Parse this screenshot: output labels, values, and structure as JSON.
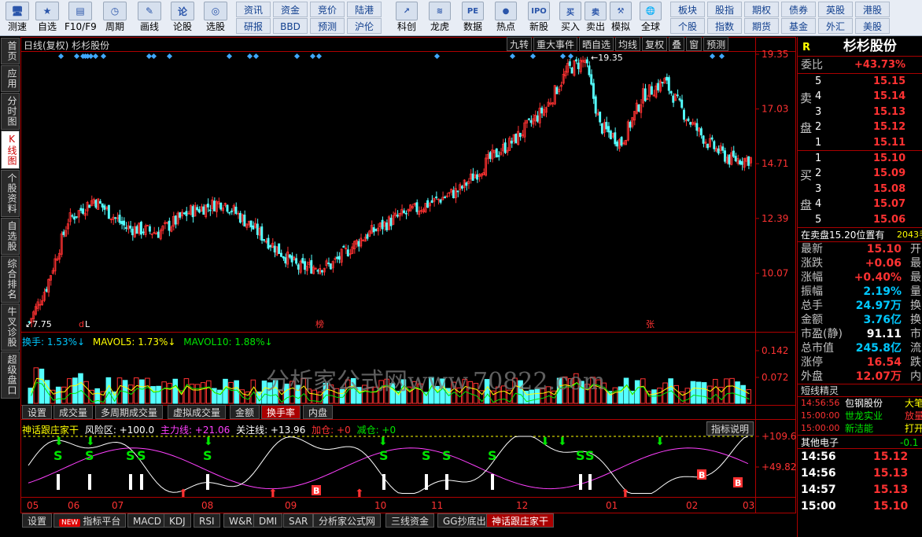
{
  "toolbar": {
    "items": [
      {
        "label": "测速",
        "icon": "🖥",
        "name": "speedtest-button"
      },
      {
        "label": "自选",
        "icon": "★",
        "name": "watchlist-button"
      },
      {
        "label": "F10/F9",
        "icon": "▤",
        "name": "f10-button"
      },
      {
        "label": "周期",
        "icon": "◷",
        "name": "period-button"
      },
      {
        "label": "画线",
        "icon": "✎",
        "name": "draw-line-button"
      },
      {
        "label": "论股",
        "icon": "论",
        "name": "forum-button"
      },
      {
        "label": "选股",
        "icon": "◎",
        "name": "stock-select-button"
      }
    ],
    "grid1": [
      "资讯",
      "资金",
      "竞价",
      "陆港",
      "研报",
      "BBD",
      "预测",
      "沪伦"
    ],
    "items2": [
      {
        "label": "科创",
        "icon": "↗",
        "name": "star-market-button"
      },
      {
        "label": "龙虎",
        "icon": "≋",
        "name": "dragon-tiger-button"
      },
      {
        "label": "数据",
        "icon": "PE",
        "name": "data-button"
      },
      {
        "label": "热点",
        "icon": "●",
        "name": "hotspot-button"
      },
      {
        "label": "新股",
        "icon": "IPO",
        "name": "ipo-button"
      },
      {
        "label": "买入",
        "icon": "买",
        "name": "buy-button"
      },
      {
        "label": "卖出",
        "icon": "卖",
        "name": "sell-button"
      },
      {
        "label": "模拟",
        "icon": "⚒",
        "name": "simulate-button"
      },
      {
        "label": "全球",
        "icon": "🌐",
        "name": "global-button"
      }
    ],
    "grid2": [
      "板块",
      "股指",
      "期权",
      "债券",
      "英股",
      "港股",
      "个股",
      "指数",
      "期货",
      "基金",
      "外汇",
      "美股"
    ]
  },
  "left_tabs": [
    {
      "label": "首页",
      "active": false
    },
    {
      "label": "应用",
      "active": false
    },
    {
      "label": "分时图",
      "active": false
    },
    {
      "label": "K线图",
      "active": true
    },
    {
      "label": "个股资料",
      "active": false
    },
    {
      "label": "自选股",
      "active": false
    },
    {
      "label": "综合排名",
      "active": false
    },
    {
      "label": "牛叉诊股",
      "active": false
    },
    {
      "label": "超级盘口",
      "active": false
    }
  ],
  "chart_header": {
    "title": "日线(复权) 杉杉股份",
    "buttons": [
      "九转",
      "重大事件",
      "晒自选",
      "均线",
      "复权",
      "叠",
      "窗",
      "预测"
    ]
  },
  "price_axis": [
    "19.35",
    "17.03",
    "14.71",
    "12.39",
    "10.07"
  ],
  "price_marks": {
    "high": "19.35",
    "low": "7.75",
    "low_label_prefix": "d",
    "labels": [
      "L",
      "榜",
      "张"
    ]
  },
  "vol_header": {
    "a": "换手: 1.53%↓",
    "b": "MAVOL5: 1.73%↓",
    "c": "MAVOL10: 1.88%↓"
  },
  "vol_axis": [
    "0.142",
    "0.072"
  ],
  "vol_tabs": [
    "设置",
    "成交量",
    "多周期成交量",
    "虚拟成交量",
    "金额",
    "换手率",
    "内盘"
  ],
  "vol_active": "换手率",
  "watermark": "分析家公式网www.70822.com",
  "ind_header": {
    "name": "神话跟庄家干",
    "risk": "风险区: +100.0",
    "main": "主力线: +21.06",
    "focus": "关注线: +13.96",
    "add": "加仓: +0",
    "reduce": "减仓: +0",
    "explain": "指标说明"
  },
  "ind_axis": [
    "+109.6",
    "+49.82"
  ],
  "month_axis": [
    "05",
    "06",
    "07",
    "08",
    "09",
    "10",
    "11",
    "12",
    "01",
    "02",
    "03"
  ],
  "bottom_tabs": [
    "设置",
    "指标平台",
    "MACD",
    "KDJ",
    "RSI",
    "W&R",
    "DMI",
    "SAR",
    "分析家公式网",
    "三线资金",
    "GG抄底出货",
    "神话跟庄家干"
  ],
  "bottom_new": "NEW",
  "bottom_active": "神话跟庄家干",
  "chart_data": {
    "type": "candlestick",
    "title": "日线(复权) 杉杉股份",
    "ylim": [
      7.75,
      19.35
    ],
    "x_months": [
      "05",
      "06",
      "07",
      "08",
      "09",
      "10",
      "11",
      "12",
      "01",
      "02",
      "03"
    ],
    "close_keypoints": [
      [
        0,
        8.0
      ],
      [
        8,
        9.5
      ],
      [
        18,
        12.3
      ],
      [
        30,
        13.2
      ],
      [
        45,
        12.0
      ],
      [
        60,
        11.8
      ],
      [
        75,
        12.7
      ],
      [
        90,
        13.1
      ],
      [
        110,
        11.5
      ],
      [
        125,
        10.3
      ],
      [
        140,
        10.4
      ],
      [
        155,
        11.6
      ],
      [
        170,
        12.4
      ],
      [
        185,
        13.0
      ],
      [
        200,
        13.6
      ],
      [
        215,
        15.0
      ],
      [
        225,
        15.7
      ],
      [
        240,
        17.1
      ],
      [
        250,
        18.7
      ],
      [
        258,
        19.1
      ],
      [
        265,
        16.3
      ],
      [
        275,
        15.6
      ],
      [
        285,
        17.6
      ],
      [
        295,
        18.2
      ],
      [
        305,
        16.7
      ],
      [
        315,
        15.6
      ],
      [
        325,
        14.9
      ],
      [
        335,
        14.9
      ]
    ],
    "indicator": {
      "risk": 100.0,
      "main": 21.06,
      "focus": 13.96
    }
  },
  "quote": {
    "header_code": "R",
    "header_name": "杉杉股份",
    "weibi_label": "委比",
    "weibi_value": "+43.73%",
    "sell_label": "卖盘",
    "buy_label": "买盘",
    "sell": [
      {
        "n": "5",
        "p": "15.15"
      },
      {
        "n": "4",
        "p": "15.14"
      },
      {
        "n": "3",
        "p": "15.13"
      },
      {
        "n": "2",
        "p": "15.12"
      },
      {
        "n": "1",
        "p": "15.11"
      }
    ],
    "buy": [
      {
        "n": "1",
        "p": "15.10"
      },
      {
        "n": "2",
        "p": "15.09"
      },
      {
        "n": "3",
        "p": "15.08"
      },
      {
        "n": "4",
        "p": "15.07"
      },
      {
        "n": "5",
        "p": "15.06"
      }
    ],
    "notice": "在卖盘15.20位置有",
    "notice_num": "2043手",
    "stats": [
      {
        "k": "最新",
        "v": "15.10",
        "c": "red",
        "t": "开"
      },
      {
        "k": "涨跌",
        "v": "+0.06",
        "c": "red",
        "t": "最"
      },
      {
        "k": "涨幅",
        "v": "+0.40%",
        "c": "red",
        "t": "最"
      },
      {
        "k": "振幅",
        "v": "2.19%",
        "c": "cyan",
        "t": "量"
      },
      {
        "k": "总手",
        "v": "24.97万",
        "c": "cyan",
        "t": "换"
      },
      {
        "k": "金额",
        "v": "3.76亿",
        "c": "cyan",
        "t": "换"
      },
      {
        "k": "市盈(静)",
        "v": "91.11",
        "c": "white",
        "t": "市"
      },
      {
        "k": "总市值",
        "v": "245.8亿",
        "c": "cyan",
        "t": "流"
      },
      {
        "k": "涨停",
        "v": "16.54",
        "c": "red",
        "t": "跌"
      },
      {
        "k": "外盘",
        "v": "12.07万",
        "c": "red",
        "t": "内"
      }
    ],
    "sprite_title": "短线精灵",
    "sprite": [
      {
        "t": "14:56:56",
        "n": "包钢股份",
        "e": "大笔"
      },
      {
        "t": "15:00:00",
        "n": "世龙实业",
        "e": "放量"
      },
      {
        "t": "15:00:00",
        "n": "新洁能",
        "e": "打开"
      }
    ],
    "other_label": "其他电子",
    "other_value": "-0.1",
    "ticks": [
      {
        "t": "14:56",
        "p": "15.12"
      },
      {
        "t": "14:56",
        "p": "15.13"
      },
      {
        "t": "14:57",
        "p": "15.13"
      },
      {
        "t": "15:00",
        "p": "15.10"
      }
    ]
  },
  "colors": {
    "up": "#ff3232",
    "down": "#54ffff",
    "border": "#b00000"
  }
}
